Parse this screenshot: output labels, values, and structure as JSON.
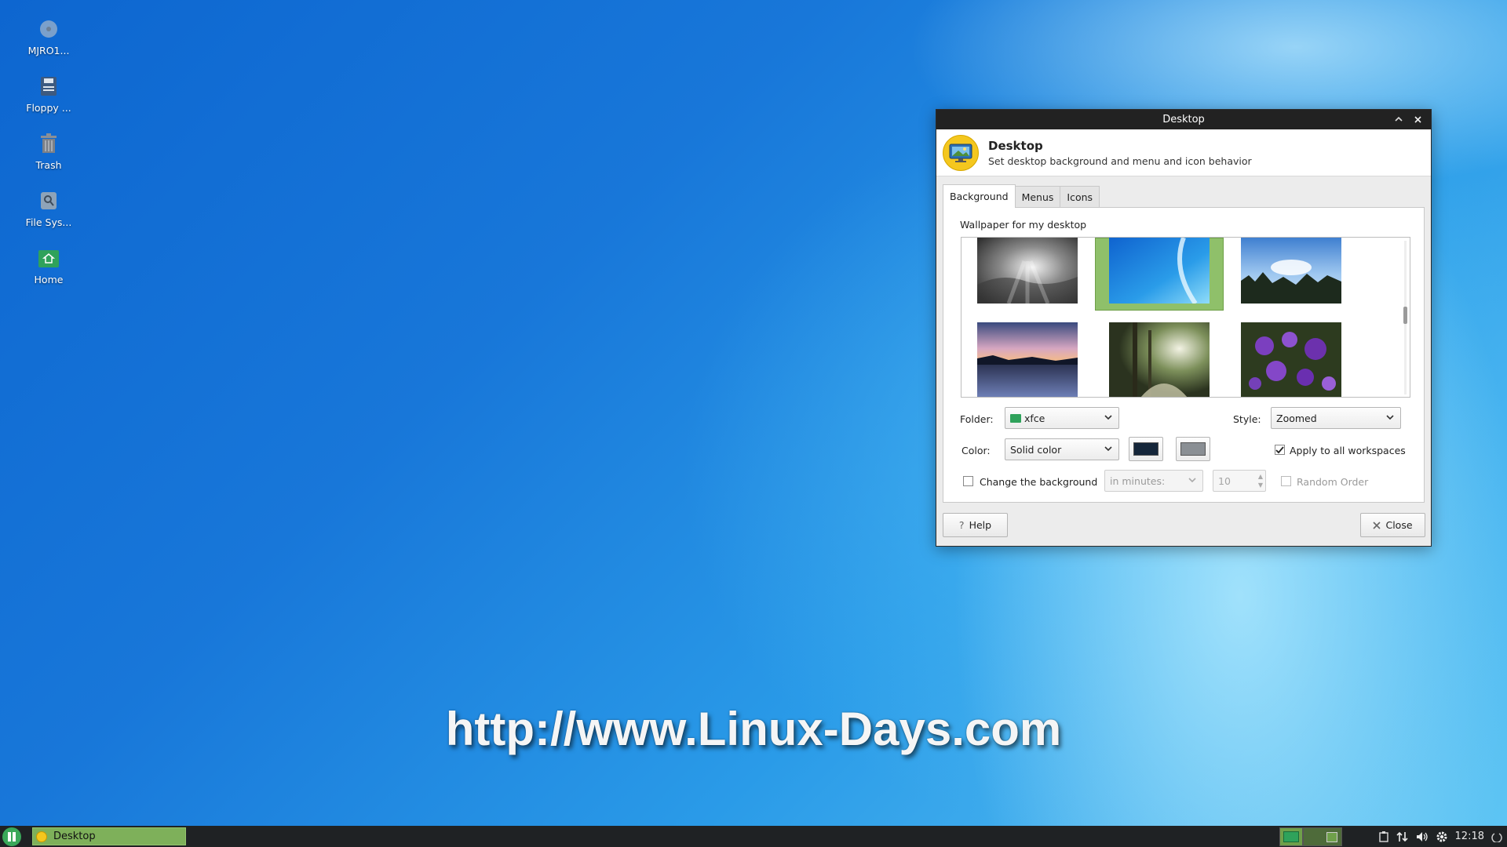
{
  "desktop": {
    "icons": [
      {
        "label": "MJRO1...",
        "icon": "disc-icon"
      },
      {
        "label": "Floppy ...",
        "icon": "floppy-icon"
      },
      {
        "label": "Trash",
        "icon": "trash-icon"
      },
      {
        "label": "File Sys...",
        "icon": "filesystem-icon"
      },
      {
        "label": "Home",
        "icon": "home-folder-icon"
      }
    ],
    "watermark": "http://www.Linux-Days.com"
  },
  "window": {
    "title": "Desktop",
    "header_title": "Desktop",
    "header_subtitle": "Set desktop background and menu and icon behavior",
    "tabs": [
      {
        "label": "Background",
        "active": true
      },
      {
        "label": "Menus",
        "active": false
      },
      {
        "label": "Icons",
        "active": false
      }
    ],
    "wallpaper_label": "Wallpaper for my desktop",
    "wallpapers": [
      {
        "name": "clouds-sunbeams",
        "selected": false
      },
      {
        "name": "blue-wave",
        "selected": true
      },
      {
        "name": "sky-treeline",
        "selected": false
      },
      {
        "name": "lake-sunset",
        "selected": false
      },
      {
        "name": "forest-path-light",
        "selected": false
      },
      {
        "name": "purple-flowers",
        "selected": false
      }
    ],
    "folder_label": "Folder:",
    "folder_value": "xfce",
    "style_label": "Style:",
    "style_value": "Zoomed",
    "color_label": "Color:",
    "color_value": "Solid color",
    "primary_color": "#15263a",
    "secondary_color": "#8a8f94",
    "apply_all_label": "Apply to all workspaces",
    "apply_all_checked": true,
    "change_bg_label": "Change the background",
    "change_bg_checked": false,
    "interval_unit": "in minutes:",
    "interval_value": "10",
    "random_order_label": "Random Order",
    "help_label": "Help",
    "close_label": "Close"
  },
  "taskbar": {
    "task_label": "Desktop",
    "clock": "12:18"
  },
  "colors": {
    "accent": "#7eb05a",
    "titlebar": "#222222"
  }
}
